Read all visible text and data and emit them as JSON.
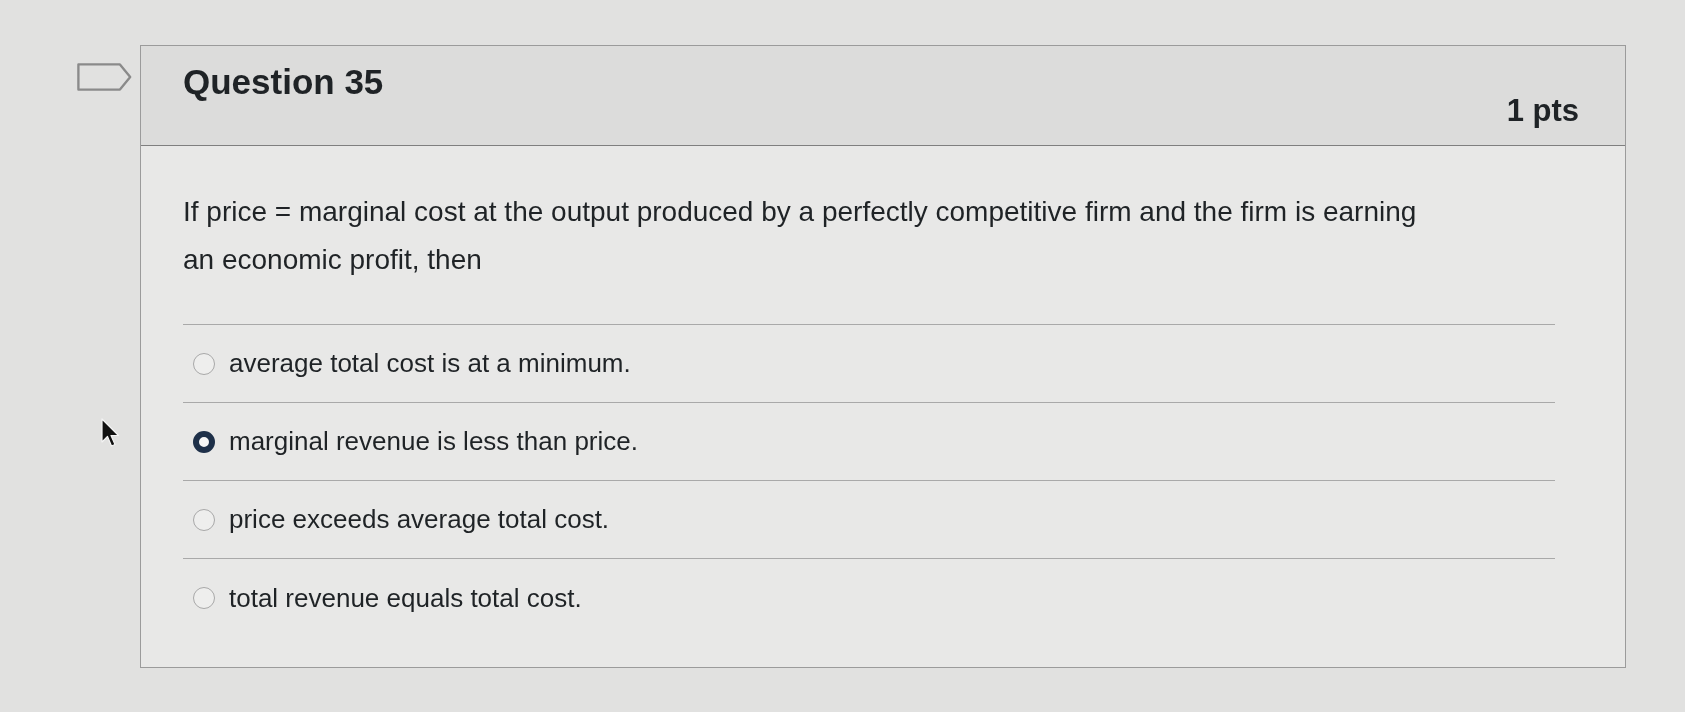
{
  "question": {
    "title": "Question 35",
    "points": "1 pts",
    "text": "If price = marginal cost at the output produced by a perfectly competitive firm and the firm is earning an economic profit, then",
    "answers": [
      {
        "label": "average total cost is at a minimum.",
        "selected": false
      },
      {
        "label": "marginal revenue is less than price.",
        "selected": true
      },
      {
        "label": "price exceeds average total cost.",
        "selected": false
      },
      {
        "label": "total revenue equals total cost.",
        "selected": false
      }
    ]
  }
}
